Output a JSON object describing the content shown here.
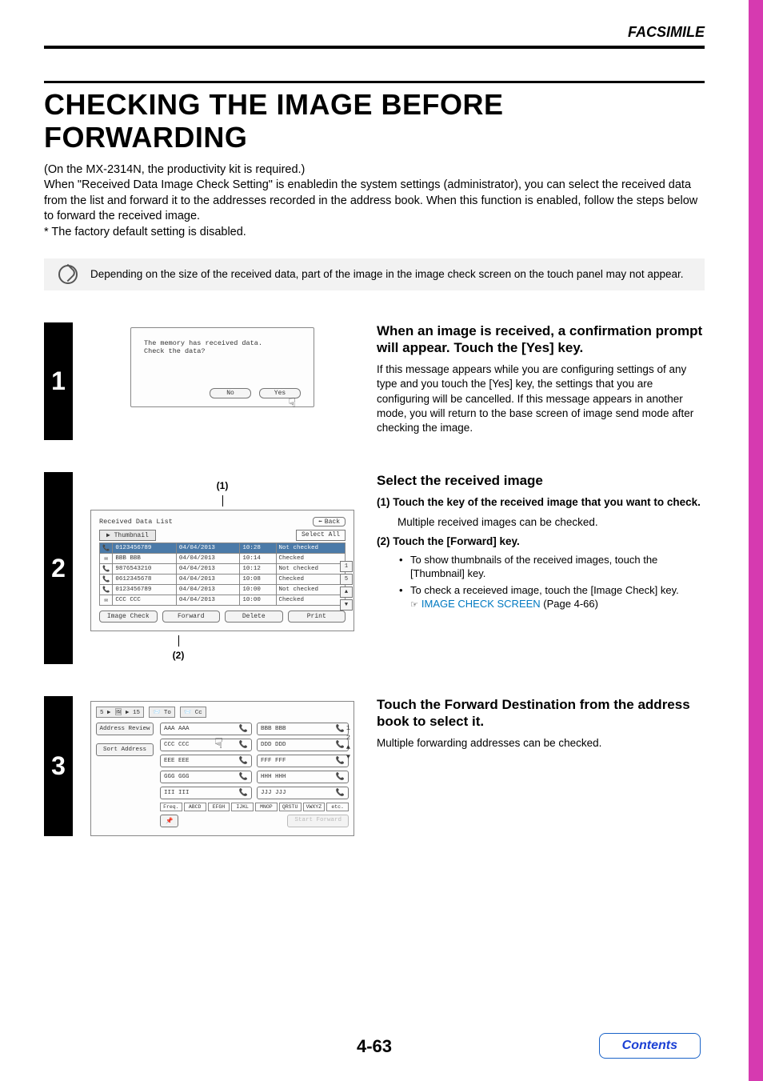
{
  "header": {
    "section": "FACSIMILE"
  },
  "title": "CHECKING THE IMAGE BEFORE FORWARDING",
  "intro": {
    "line1": "(On the MX-2314N, the productivity kit is required.)",
    "line2": "When \"Received Data Image Check Setting\" is enabledin the system settings (administrator), you can select the received data from the list and forward it to the addresses recorded in the address book. When this function is enabled, follow the steps below to forward the received image.",
    "line3": "* The factory default setting is disabled."
  },
  "note": "Depending on the size of the received data, part of the image in the image check screen on the touch panel may not appear.",
  "steps": {
    "s1": {
      "num": "1",
      "screen": {
        "msg1": "The memory has received data.",
        "msg2": "Check the data?",
        "no": "No",
        "yes": "Yes"
      },
      "heading": "When an image is received, a confirmation prompt will appear. Touch the [Yes] key.",
      "body": "If this message appears while you are configuring settings of any type and you touch the [Yes] key, the settings that you are configuring will be cancelled. If this message appears in another mode, you will return to the base screen of image send mode after checking the image."
    },
    "s2": {
      "num": "2",
      "callout1": "(1)",
      "callout2": "(2)",
      "screen": {
        "title": "Received Data List",
        "back": "Back",
        "thumbnail": "Thumbnail",
        "select_all": "Select All",
        "rows": [
          {
            "ic": "📞",
            "addr": "0123456789",
            "date": "04/04/2013",
            "time": "10:28",
            "status": "Not checked"
          },
          {
            "ic": "✉",
            "addr": "BBB BBB",
            "date": "04/04/2013",
            "time": "10:14",
            "status": "Checked"
          },
          {
            "ic": "📞",
            "addr": "9876543210",
            "date": "04/04/2013",
            "time": "10:12",
            "status": "Not checked"
          },
          {
            "ic": "📞",
            "addr": "0612345678",
            "date": "04/04/2013",
            "time": "10:08",
            "status": "Checked"
          },
          {
            "ic": "📞",
            "addr": "0123456789",
            "date": "04/04/2013",
            "time": "10:00",
            "status": "Not checked"
          },
          {
            "ic": "✉",
            "addr": "CCC CCC",
            "date": "04/04/2013",
            "time": "10:00",
            "status": "Checked"
          }
        ],
        "pager": {
          "cur": "1",
          "total": "5",
          "up": "▲",
          "down": "▼"
        },
        "actions": {
          "image_check": "Image Check",
          "forward": "Forward",
          "delete": "Delete",
          "print": "Print"
        }
      },
      "heading": "Select the received image",
      "sub1": "(1)  Touch the key of the received image that you want to check.",
      "sub1_desc": "Multiple received images can be checked.",
      "sub2": "(2)  Touch the [Forward] key.",
      "bul1": "To show thumbnails of the received images, touch the [Thumbnail] key.",
      "bul2": "To check a receieved image, touch the [Image Check] key.",
      "link_prefix": "☞ ",
      "link": "IMAGE CHECK SCREEN",
      "link_suffix": " (Page 4-66)"
    },
    "s3": {
      "num": "3",
      "screen": {
        "breadcrumb": "5 ▶ 🖼 ▶ 15",
        "to": "To",
        "cc": "Cc",
        "address_review": "Address Review",
        "sort_address": "Sort Address",
        "cells": [
          "AAA AAA",
          "BBB BBB",
          "CCC CCC",
          "DDD DDD",
          "EEE EEE",
          "FFF FFF",
          "GGG GGG",
          "HHH HHH",
          "III III",
          "JJJ JJJ"
        ],
        "alpha": [
          "Freq.",
          "ABCD",
          "EFGH",
          "IJKL",
          "MNOP",
          "QRSTU",
          "VWXYZ",
          "etc."
        ],
        "start_forward": "Start Forward",
        "pager": {
          "cur": "1",
          "total": "2",
          "up": "▲",
          "down": "▼"
        },
        "pin": "📌"
      },
      "heading": "Touch the Forward Destination from the address book to select it.",
      "body": "Multiple forwarding addresses can be checked."
    }
  },
  "footer": {
    "page": "4-63",
    "contents": "Contents"
  }
}
